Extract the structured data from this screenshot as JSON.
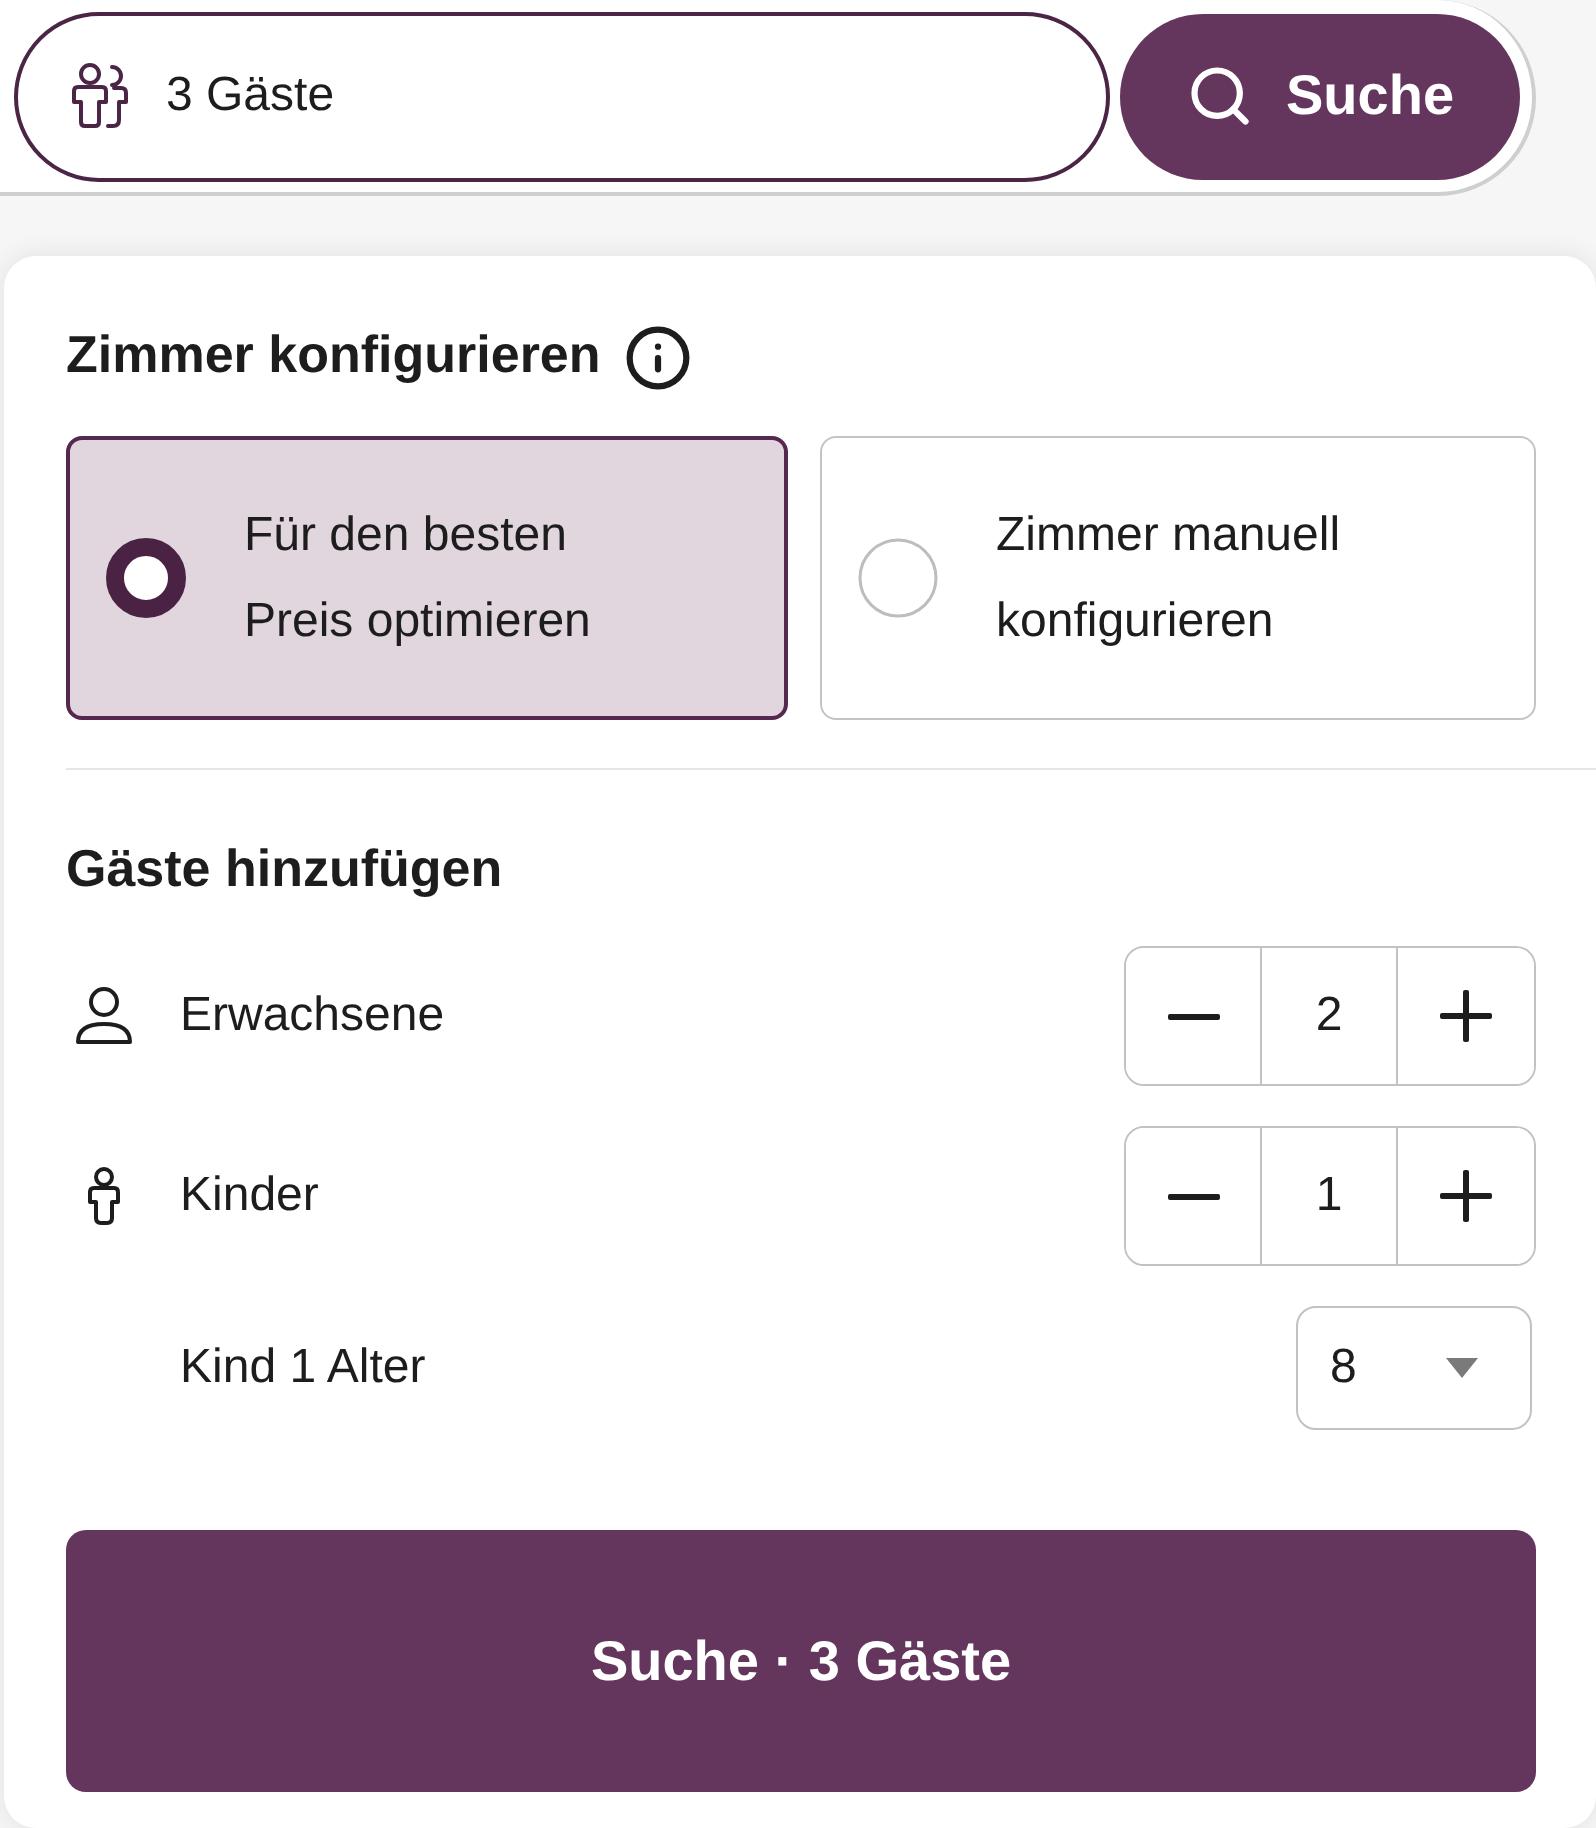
{
  "search_bar": {
    "guests_field": {
      "value": "3 Gäste"
    },
    "search_button": {
      "label": "Suche"
    }
  },
  "panel": {
    "room_config": {
      "title": "Zimmer konfigurieren",
      "options": [
        {
          "label": "Für den besten Preis optimieren",
          "selected": true
        },
        {
          "label": "Zimmer manuell konfigurieren",
          "selected": false
        }
      ]
    },
    "guests": {
      "title": "Gäste hinzufügen",
      "rows": [
        {
          "kind": "adults",
          "label": "Erwachsene",
          "count": "2"
        },
        {
          "kind": "children",
          "label": "Kinder",
          "count": "1"
        },
        {
          "kind": "child_age",
          "label": "Kind 1 Alter",
          "value": "8"
        }
      ]
    },
    "submit_button": {
      "label": "Suche · 3 Gäste"
    }
  }
}
